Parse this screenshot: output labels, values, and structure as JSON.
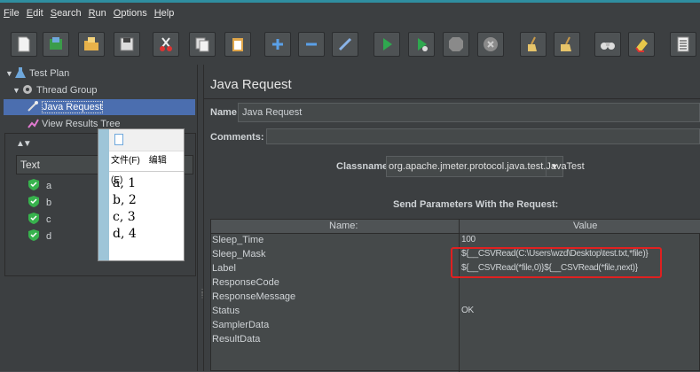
{
  "menu": [
    {
      "key": "F",
      "rest": "ile"
    },
    {
      "key": "E",
      "rest": "dit"
    },
    {
      "key": "S",
      "rest": "earch"
    },
    {
      "key": "R",
      "rest": "un"
    },
    {
      "key": "O",
      "rest": "ptions"
    },
    {
      "key": "H",
      "rest": "elp"
    }
  ],
  "tree": {
    "test_plan": "Test Plan",
    "thread_group": "Thread Group",
    "java_request": "Java Request",
    "view_results_tree": "View Results Tree"
  },
  "results_panel": {
    "sort_glyph": "▲▼",
    "column_header": "Text",
    "items": [
      "a",
      "b",
      "c",
      "d"
    ]
  },
  "notepad": {
    "menu_file": "文件(F)",
    "menu_edit": "编辑(E)",
    "lines": [
      "a, 1",
      "b, 2",
      "c, 3",
      "d, 4"
    ]
  },
  "request": {
    "title": "Java Request",
    "name_label": "Name:",
    "name_value": "Java Request",
    "comments_label": "Comments:",
    "classname_label": "Classname:",
    "classname_value": "org.apache.jmeter.protocol.java.test.JavaTest",
    "params_title": "Send Parameters With the Request:",
    "col_name": "Name:",
    "col_value": "Value",
    "params": [
      {
        "name": "Sleep_Time",
        "value": "100"
      },
      {
        "name": "Sleep_Mask",
        "value": "${__CSVRead(C:\\Users\\wzd\\Desktop\\test.txt,*file)}"
      },
      {
        "name": "Label",
        "value": "${__CSVRead(*file,0)}${__CSVRead(*file,next)}"
      },
      {
        "name": "ResponseCode",
        "value": ""
      },
      {
        "name": "ResponseMessage",
        "value": ""
      },
      {
        "name": "Status",
        "value": "OK"
      },
      {
        "name": "SamplerData",
        "value": ""
      },
      {
        "name": "ResultData",
        "value": ""
      }
    ]
  },
  "colors": {
    "accent_selection": "#4b6eaf",
    "highlight_box": "#e02020",
    "panel": "#3c3f41"
  }
}
